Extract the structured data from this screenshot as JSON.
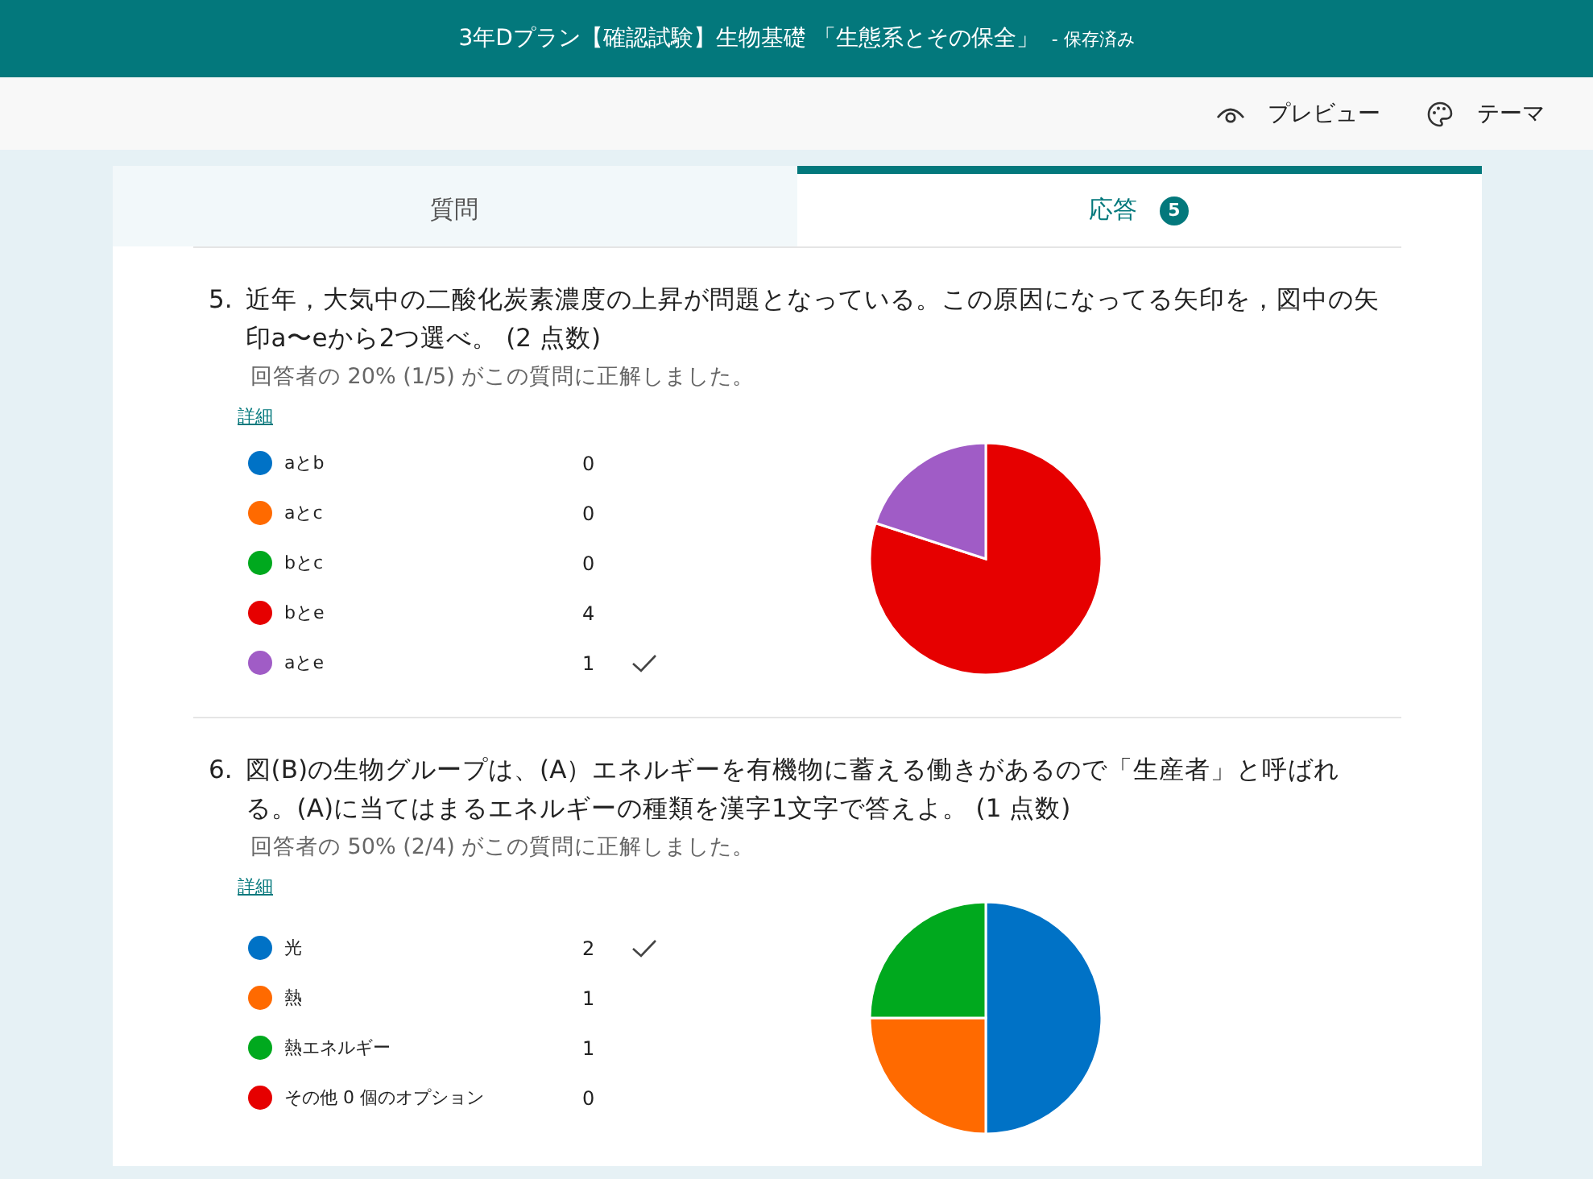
{
  "header": {
    "title": "3年Dプラン【確認試験】生物基礎 「生態系とその保全」",
    "status": "- 保存済み"
  },
  "toolbar": [
    {
      "label": "プレビュー",
      "kind": "eye"
    },
    {
      "label": "テーマ",
      "kind": "palette"
    }
  ],
  "tabs": [
    {
      "label": "質問",
      "selected": false
    },
    {
      "label": "応答",
      "selected": true,
      "badge": "5"
    }
  ],
  "questions": [
    {
      "number": "5.",
      "text": "近年，大気中の二酸化炭素濃度の上昇が問題となっている。この原因になってる矢印を，図中の矢印a〜eから2つ選べ。 (2 点数)",
      "summary": "回答者の 20% (1/5) がこの質問に正解しました。",
      "details": "詳細",
      "options": [
        {
          "label": "aとb",
          "count": "0",
          "color": "#0072c6",
          "correct": false
        },
        {
          "label": "aとc",
          "count": "0",
          "color": "#ff6a00",
          "correct": false
        },
        {
          "label": "bとc",
          "count": "0",
          "color": "#00a91e",
          "correct": false
        },
        {
          "label": "bとe",
          "count": "4",
          "color": "#e60000",
          "correct": false
        },
        {
          "label": "aとe",
          "count": "1",
          "color": "#a05cc6",
          "correct": true
        }
      ],
      "chart_data": {
        "type": "pie",
        "values": [
          0,
          0,
          0,
          80,
          20
        ]
      }
    },
    {
      "number": "6.",
      "text": "図(B)の生物グループは、(A）エネルギーを有機物に蓄える働きがあるので「生産者」と呼ばれる。(A)に当てはまるエネルギーの種類を漢字1文字で答えよ。 (1 点数)",
      "summary": "回答者の 50% (2/4) がこの質問に正解しました。",
      "details": "詳細",
      "options": [
        {
          "label": "光",
          "count": "2",
          "color": "#0072c6",
          "correct": true
        },
        {
          "label": "熱",
          "count": "1",
          "color": "#ff6a00",
          "correct": false
        },
        {
          "label": "熱エネルギー",
          "count": "1",
          "color": "#00a91e",
          "correct": false
        },
        {
          "label": "その他 0 個のオプション",
          "count": "0",
          "color": "#e60000",
          "correct": false
        }
      ],
      "chart_data": {
        "type": "pie",
        "values": [
          50,
          25,
          25,
          0
        ]
      }
    }
  ]
}
